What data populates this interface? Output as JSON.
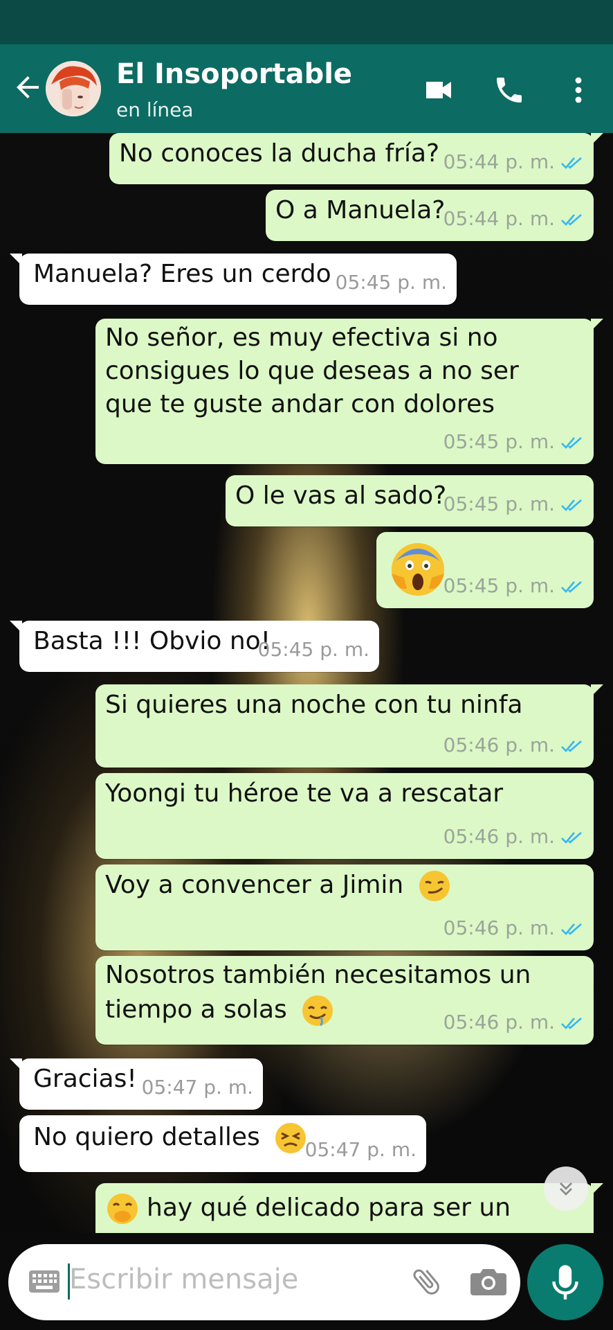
{
  "header": {
    "contact_name": "El Insoportable",
    "status": "en línea",
    "icons": [
      "back-arrow-icon",
      "video-call-icon",
      "phone-icon",
      "more-vert-icon"
    ]
  },
  "messages": [
    {
      "dir": "out",
      "text": "No conoces la ducha fría?",
      "time": "05:44 p. m."
    },
    {
      "dir": "out",
      "text": "O a Manuela?",
      "time": "05:44 p. m."
    },
    {
      "dir": "in",
      "text": "Manuela? Eres un cerdo",
      "time": "05:45 p. m."
    },
    {
      "dir": "out",
      "lines": [
        "No señor, es muy efectiva si no",
        "consigues lo que deseas a no ser",
        "que te guste andar con dolores"
      ],
      "time": "05:45 p. m."
    },
    {
      "dir": "out",
      "text": "O le vas al sado?",
      "time": "05:45 p. m."
    },
    {
      "dir": "out",
      "emoji": "😱",
      "time": "05:45 p. m."
    },
    {
      "dir": "in",
      "text": "Basta !!! Obvio no!",
      "time": "05:45 p. m."
    },
    {
      "dir": "out",
      "text": "Si quieres una noche con tu ninfa",
      "time": "05:46 p. m."
    },
    {
      "dir": "out",
      "text": "Yoongi tu héroe te va a rescatar",
      "time": "05:46 p. m."
    },
    {
      "dir": "out",
      "text": "Voy a convencer a Jimin",
      "emoji": "😏",
      "time": "05:46 p. m."
    },
    {
      "dir": "out",
      "lines": [
        "Nosotros también necesitamos un",
        "tiempo a solas"
      ],
      "emoji": "🤤",
      "time": "05:46 p. m."
    },
    {
      "dir": "in",
      "text": "Gracias!",
      "time": "05:47 p. m."
    },
    {
      "dir": "in",
      "text": "No quiero detalles",
      "emoji": "😣",
      "time": "05:47 p. m."
    },
    {
      "dir": "out",
      "text": "hay qué delicado para ser un",
      "emoji": "🤭"
    }
  ],
  "composer": {
    "placeholder": "Escribir mensaje"
  },
  "colors": {
    "header": "#0c6b62",
    "statusbar": "#0b4a45",
    "outgoing_bubble": "#dcf8c6",
    "incoming_bubble": "#ffffff",
    "read_ticks": "#34b7f1",
    "mic_button": "#0a7c6f"
  }
}
